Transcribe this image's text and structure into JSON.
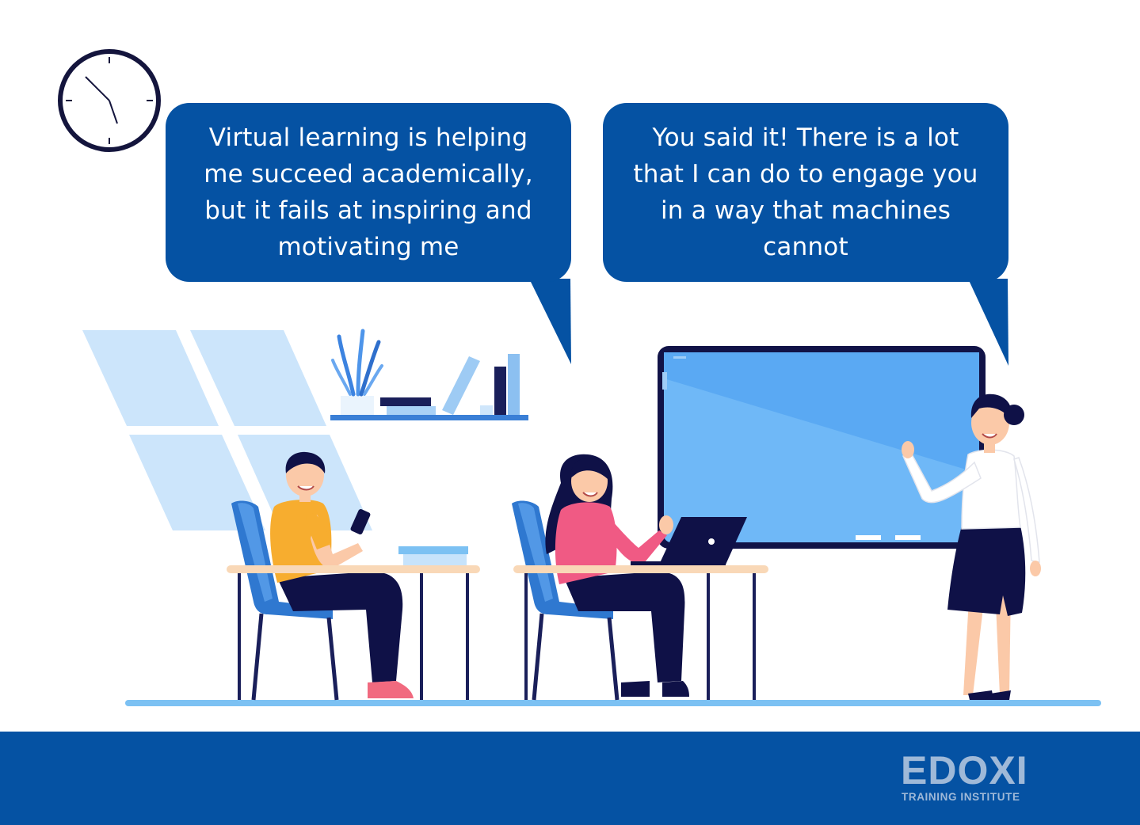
{
  "bubbles": {
    "student": "Virtual learning is helping me succeed academically, but it fails at inspiring and motivating me",
    "teacher": "You said it! There is a lot that I can do to engage you in a way that machines cannot"
  },
  "logo": {
    "wordmark": "EDOXI",
    "tagline": "TRAINING INSTITUTE"
  },
  "colors": {
    "brand_blue": "#0552a3",
    "board_blue": "#6fb8f7",
    "navy": "#0f1147",
    "window_blue": "#cce5fb"
  },
  "icons": [
    "clock-icon",
    "plant-icon",
    "laptop-icon",
    "smartphone-icon",
    "globe-icon"
  ]
}
